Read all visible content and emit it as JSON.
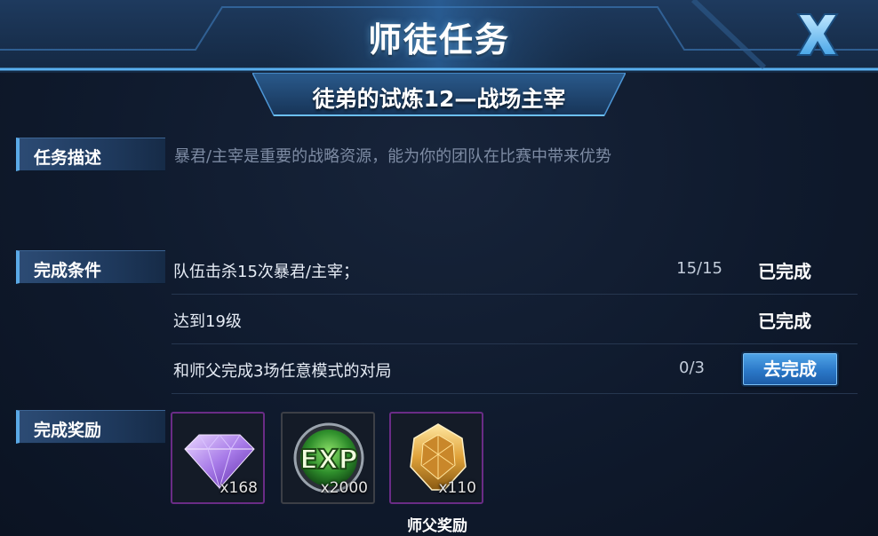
{
  "window": {
    "title": "师徒任务",
    "subtitle": "徒弟的试炼12—战场主宰"
  },
  "description": {
    "tab_label": "任务描述",
    "text": "暴君/主宰是重要的战略资源，能为你的团队在比赛中带来优势"
  },
  "conditions": {
    "tab_label": "完成条件",
    "items": [
      {
        "label": "队伍击杀15次暴君/主宰；",
        "progress": "15/15",
        "status": "已完成"
      },
      {
        "label": "达到19级",
        "progress": "",
        "status": "已完成"
      },
      {
        "label": "和师父完成3场任意模式的对局",
        "progress": "0/3",
        "button": "去完成"
      }
    ]
  },
  "rewards": {
    "tab_label": "完成奖励",
    "items": [
      {
        "icon": "purple-diamond-icon",
        "count": "x168"
      },
      {
        "icon": "exp-orb-icon",
        "count": "x2000"
      },
      {
        "icon": "gold-medal-icon",
        "count": "x110"
      }
    ],
    "mentor_caption": "师父奖励"
  },
  "colors": {
    "background": "#0f1a2d",
    "accent_blue": "#4fa3e6",
    "reward_border_purple": "#6a2c86",
    "muted_text": "#7d8ba3"
  }
}
